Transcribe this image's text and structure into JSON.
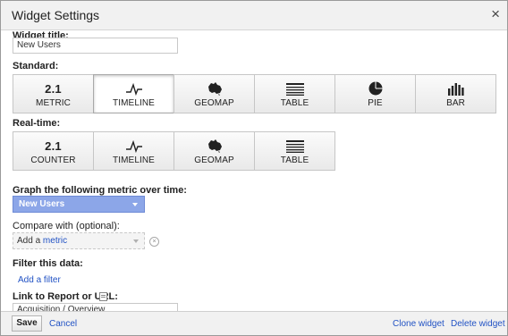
{
  "dialog": {
    "title": "Widget Settings",
    "close_glyph": "×"
  },
  "widget_title": {
    "label": "Widget title:",
    "value": "New Users"
  },
  "standard": {
    "label": "Standard:",
    "options": [
      {
        "num": "2.1",
        "label": "METRIC",
        "icon": "metric-number-icon",
        "selected": false
      },
      {
        "label": "TIMELINE",
        "icon": "timeline-icon",
        "selected": true
      },
      {
        "label": "GEOMAP",
        "icon": "geomap-icon",
        "selected": false
      },
      {
        "label": "TABLE",
        "icon": "table-icon",
        "selected": false
      },
      {
        "label": "PIE",
        "icon": "pie-icon",
        "selected": false
      },
      {
        "label": "BAR",
        "icon": "bar-chart-icon",
        "selected": false
      }
    ]
  },
  "realtime": {
    "label": "Real-time:",
    "options": [
      {
        "num": "2.1",
        "label": "COUNTER",
        "icon": "counter-number-icon"
      },
      {
        "label": "TIMELINE",
        "icon": "timeline-icon"
      },
      {
        "label": "GEOMAP",
        "icon": "geomap-icon"
      },
      {
        "label": "TABLE",
        "icon": "table-icon"
      }
    ]
  },
  "graph_metric": {
    "label": "Graph the following metric over time:",
    "value": "New Users"
  },
  "compare": {
    "label": "Compare with (optional):",
    "prefix": "Add a",
    "metric_word": "metric"
  },
  "filter": {
    "label": "Filter this data:",
    "link": "Add a filter"
  },
  "link_report": {
    "label": "Link to Report or URL:",
    "value": "Acquisition / Overview"
  },
  "footer": {
    "save": "Save",
    "cancel": "Cancel",
    "clone": "Clone widget",
    "delete": "Delete widget"
  },
  "colors": {
    "accent": "#8ca6e8",
    "link": "#2152c4",
    "titlebar": "#f1f1f1"
  }
}
